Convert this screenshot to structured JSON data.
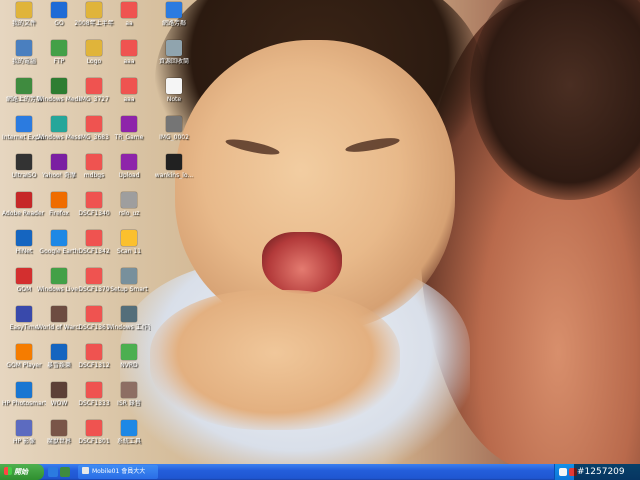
{
  "desktop": {
    "wallpaper": "toddler-laughing-photo",
    "icons": [
      {
        "label": "我的文件",
        "icon": "folder-icon",
        "color": "#e0b43a"
      },
      {
        "label": "我的電腦",
        "icon": "computer-icon",
        "color": "#4a7fbf"
      },
      {
        "label": "網路上的芳鄰",
        "icon": "network-icon",
        "color": "#3f8b3f"
      },
      {
        "label": "Internet Explorer",
        "icon": "ie-icon",
        "color": "#2b7be0"
      },
      {
        "label": "UltraISO",
        "icon": "disc-icon",
        "color": "#333333"
      },
      {
        "label": "Adobe Reader 8.0",
        "icon": "pdf-icon",
        "color": "#c62828"
      },
      {
        "label": "HiNet",
        "icon": "hinet-icon",
        "color": "#1565c0"
      },
      {
        "label": "GOM",
        "icon": "gom-icon",
        "color": "#d32f2f"
      },
      {
        "label": "EasyTime",
        "icon": "easy-icon",
        "color": "#3949ab"
      },
      {
        "label": "GOM Player",
        "icon": "player-icon",
        "color": "#f57c00"
      },
      {
        "label": "HP Photosmart Essential",
        "icon": "hp-icon",
        "color": "#1976d2"
      },
      {
        "label": "HP 影像",
        "icon": "camera-icon",
        "color": "#5c6bc0"
      },
      {
        "label": "GO",
        "icon": "go-icon",
        "color": "#1e6bd6"
      },
      {
        "label": "FTP",
        "icon": "ftp-icon",
        "color": "#43a047"
      },
      {
        "label": "Windows Media Player",
        "icon": "media-icon",
        "color": "#2e7d32"
      },
      {
        "label": "Windows Messenger",
        "icon": "messenger-icon",
        "color": "#26a69a"
      },
      {
        "label": "Yahoo! 奇摩",
        "icon": "yahoo-icon",
        "color": "#7b1fa2"
      },
      {
        "label": "Firefox",
        "icon": "firefox-icon",
        "color": "#ef6c00"
      },
      {
        "label": "Google Earth",
        "icon": "earth-icon",
        "color": "#1e88e5"
      },
      {
        "label": "Windows Live Messenger",
        "icon": "live-icon",
        "color": "#43a047"
      },
      {
        "label": "World of Warcraft",
        "icon": "wow-icon",
        "color": "#6d4c41"
      },
      {
        "label": "暴雪娛樂",
        "icon": "blizzard-icon",
        "color": "#1565c0"
      },
      {
        "label": "WOW",
        "icon": "wow2-icon",
        "color": "#5d4037"
      },
      {
        "label": "魔獸世界",
        "icon": "warcraft-icon",
        "color": "#795548"
      },
      {
        "label": "2008年上半年",
        "icon": "folder2-icon",
        "color": "#e0b43a"
      },
      {
        "label": "Logo",
        "icon": "folder3-icon",
        "color": "#e0b43a"
      },
      {
        "label": "IMG_3727",
        "icon": "image-icon",
        "color": "#ef5350"
      },
      {
        "label": "IMG_3683",
        "icon": "image2-icon",
        "color": "#ef5350"
      },
      {
        "label": "mdbgs",
        "icon": "file-icon",
        "color": "#ef5350"
      },
      {
        "label": "DSCF1340",
        "icon": "image3-icon",
        "color": "#ef5350"
      },
      {
        "label": "DSCF1342",
        "icon": "image4-icon",
        "color": "#ef5350"
      },
      {
        "label": "DSCF1379",
        "icon": "image5-icon",
        "color": "#ef5350"
      },
      {
        "label": "DSCF1367",
        "icon": "image6-icon",
        "color": "#ef5350"
      },
      {
        "label": "DSCF1312",
        "icon": "image7-icon",
        "color": "#ef5350"
      },
      {
        "label": "DSCF1333",
        "icon": "image8-icon",
        "color": "#ef5350"
      },
      {
        "label": "DSCF1301",
        "icon": "image9-icon",
        "color": "#ef5350"
      },
      {
        "label": "aa",
        "icon": "doc-icon",
        "color": "#ef5350"
      },
      {
        "label": "aaa",
        "icon": "doc2-icon",
        "color": "#ef5350"
      },
      {
        "label": "aaa",
        "icon": "doc3-icon",
        "color": "#ef5350"
      },
      {
        "label": "TR_Game",
        "icon": "winrar-icon",
        "color": "#8e24aa"
      },
      {
        "label": "Upload",
        "icon": "winrar2-icon",
        "color": "#8e24aa"
      },
      {
        "label": "rslo_uz",
        "icon": "text-icon",
        "color": "#9e9e9e"
      },
      {
        "label": "Scan 11",
        "icon": "scan-icon",
        "color": "#fbc02d"
      },
      {
        "label": "Setup Smart",
        "icon": "setup-icon",
        "color": "#78909c"
      },
      {
        "label": "Windows 工作管理員",
        "icon": "taskmgr-icon",
        "color": "#546e7a"
      },
      {
        "label": "NVRD",
        "icon": "nv-icon",
        "color": "#4caf50"
      },
      {
        "label": "ISR 錄音",
        "icon": "sound-icon",
        "color": "#8d6e63"
      },
      {
        "label": "系統工具",
        "icon": "tool-icon",
        "color": "#1e88e5"
      },
      {
        "label": "網路芳鄰",
        "icon": "ie2-icon",
        "color": "#2b7be0"
      },
      {
        "label": "資源回收筒",
        "icon": "recycle-icon",
        "color": "#90a4ae"
      },
      {
        "label": "Note",
        "icon": "note-icon",
        "color": "#f5f5f5"
      },
      {
        "label": "IMG_0002",
        "icon": "img-icon",
        "color": "#757575"
      },
      {
        "label": "wankins_lo...",
        "icon": "window-icon",
        "color": "#212121"
      }
    ]
  },
  "taskbar": {
    "start_label": "開始",
    "task_label": "Mobile01 會員大大",
    "watermark": "#1257209"
  }
}
